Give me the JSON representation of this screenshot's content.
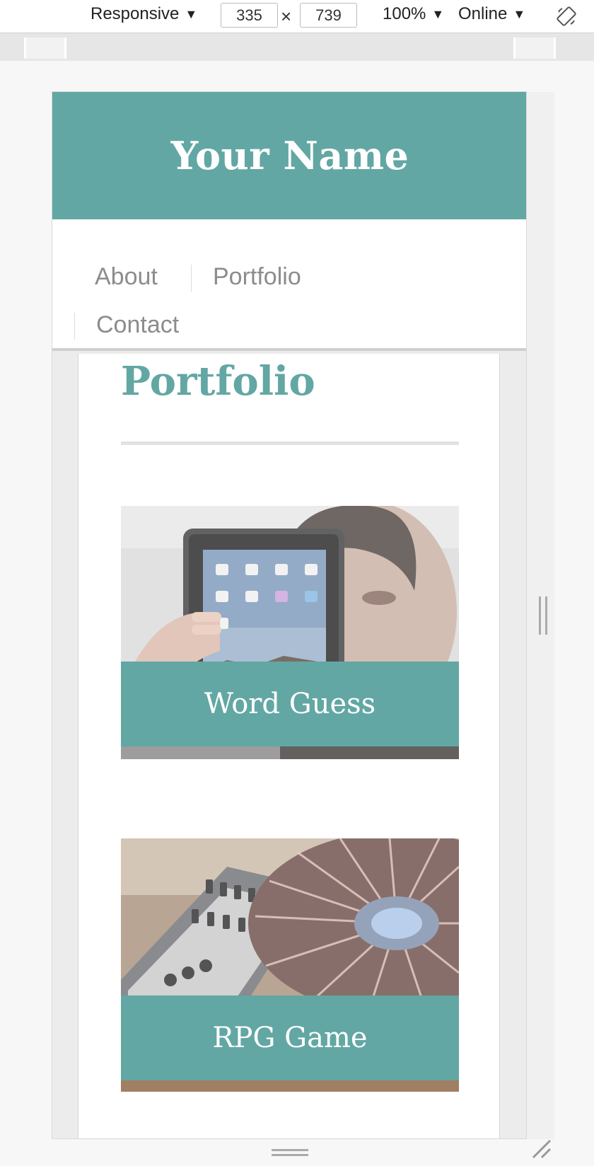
{
  "devtools": {
    "device_mode": "Responsive",
    "width": "335",
    "separator": "×",
    "height": "739",
    "zoom": "100%",
    "network": "Online",
    "arrow": "▼"
  },
  "site": {
    "title": "Your Name",
    "nav": [
      {
        "label": "About"
      },
      {
        "label": "Portfolio"
      },
      {
        "label": "Contact"
      }
    ],
    "page_heading": "Portfolio",
    "projects": [
      {
        "title": "Word Guess",
        "image": "person-holding-tablet"
      },
      {
        "title": "RPG Game",
        "image": "dj-turntable"
      }
    ]
  },
  "colors": {
    "accent": "#62a7a3",
    "nav_text": "#8c8c8c"
  }
}
